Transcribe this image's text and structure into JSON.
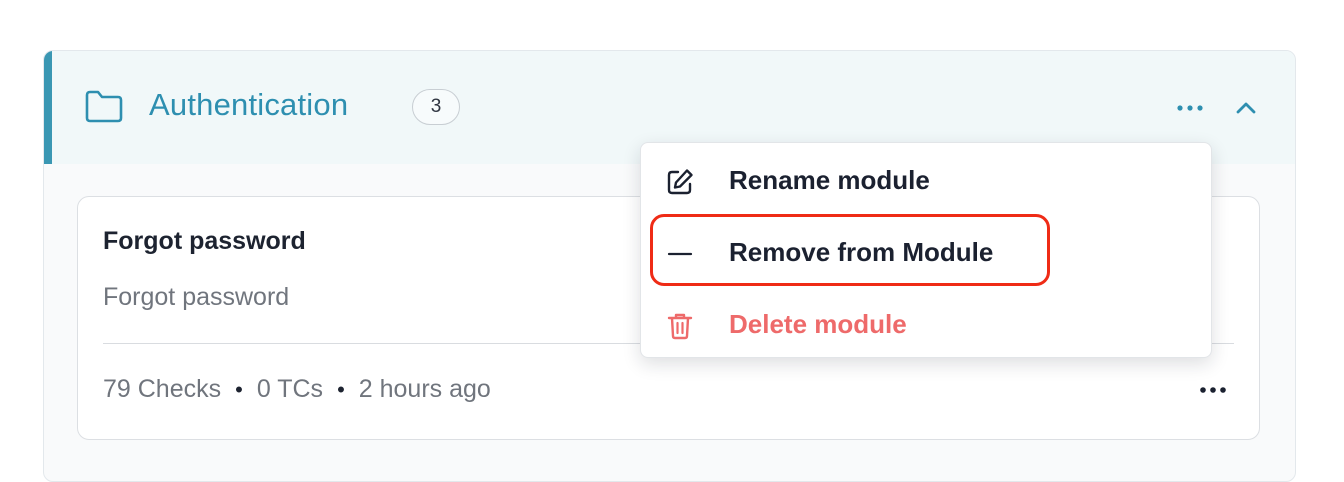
{
  "module": {
    "title": "Authentication",
    "count": "3",
    "more_icon": "more-horizontal-icon",
    "collapse_icon": "chevron-up-icon",
    "folder_icon": "folder-icon",
    "accent_color": "#3a97b3"
  },
  "test_case": {
    "title": "Forgot password",
    "description": "Forgot password",
    "checks": "79 Checks",
    "tcs": "0 TCs",
    "updated": "2 hours ago",
    "separator": "•"
  },
  "context_menu": {
    "items": [
      {
        "label": "Rename module",
        "icon": "edit-icon"
      },
      {
        "label": "Remove from Module",
        "icon": "minus-icon",
        "highlighted": true
      },
      {
        "label": "Delete module",
        "icon": "trash-icon",
        "color": "#ee6a6a"
      }
    ],
    "highlight_color": "#ef2b16"
  }
}
